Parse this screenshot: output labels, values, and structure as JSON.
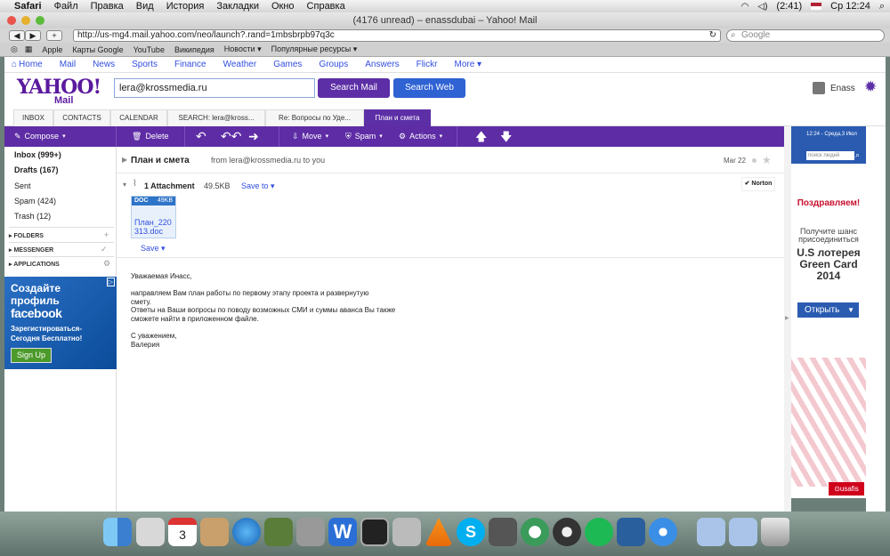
{
  "menubar": {
    "apple": "",
    "app": "Safari",
    "items": [
      "Файл",
      "Правка",
      "Вид",
      "История",
      "Закладки",
      "Окно",
      "Справка"
    ],
    "battery": "(2:41)",
    "clock": "Ср 12:24"
  },
  "window": {
    "title": "(4176 unread) – enassdubai – Yahoo! Mail",
    "url": "http://us-mg4.mail.yahoo.com/neo/launch?.rand=1mbsbrpb97q3c",
    "search_placeholder": "Google"
  },
  "bookmarks": [
    "Apple",
    "Карты Google",
    "YouTube",
    "Википедия",
    "Новости ▾",
    "Популярные ресурсы ▾"
  ],
  "yahoo_nav": [
    "Home",
    "Mail",
    "News",
    "Sports",
    "Finance",
    "Weather",
    "Games",
    "Groups",
    "Answers",
    "Flickr",
    "More ▾"
  ],
  "header": {
    "logo": "YAHOO!",
    "logo_sub": "Mail",
    "search_value": "lera@krossmedia.ru",
    "search_mail": "Search Mail",
    "search_web": "Search Web",
    "user": "Enass"
  },
  "tabs": [
    "INBOX",
    "CONTACTS",
    "CALENDAR",
    "SEARCH: lera@kross...",
    "Re: Вопросы по Уде...",
    "План и смета"
  ],
  "actions": {
    "compose": "Compose",
    "delete": "Delete",
    "move": "Move",
    "spam": "Spam",
    "actions": "Actions"
  },
  "sidebar": {
    "folders": [
      {
        "label": "Inbox (999+)",
        "bold": true
      },
      {
        "label": "Drafts (167)",
        "bold": true
      },
      {
        "label": "Sent",
        "bold": false
      },
      {
        "label": "Spam (424)",
        "bold": false
      },
      {
        "label": "Trash (12)",
        "bold": false
      }
    ],
    "sections": [
      "FOLDERS",
      "MESSENGER",
      "APPLICATIONS"
    ],
    "ad": {
      "line1": "Создайте",
      "line2": "профиль",
      "brand": "facebook",
      "line3": "Зарегистироваться-",
      "line4": "Сегодня Бесплатно!",
      "button": "Sign Up"
    }
  },
  "message": {
    "subject": "План и смета",
    "from": "from lera@krossmedia.ru to you",
    "date": "Mar 22",
    "attachments_label": "1 Attachment",
    "attachments_size": "49.5KB",
    "save_to": "Save to",
    "file": {
      "type": "DOC",
      "size": "49KB",
      "name": "План_220313.doc",
      "save": "Save"
    },
    "body": [
      "Уважаемая Инасс,",
      "",
      "направляем  Вам  план  работы  по  первому этапу проекта и развернутую",
      "смету.",
      "Ответы на Ваши вопросы по поводу возможных СМИ и суммы аванса Вы также",
      "сможете найти в приложенном файле.",
      "",
      "С уважением,",
      "Валерия"
    ]
  },
  "right_ad": {
    "top": "12:24 - Среда,3 Июл",
    "search": "поиск людей",
    "headline": "Поздравляем!",
    "sub1": "Получите шанс",
    "sub2": "присоединиться",
    "big1": "U.S лотерея",
    "big2": "Green Card",
    "big3": "2014",
    "button": "Открыть",
    "brand": "usafis"
  },
  "colors": {
    "yahoo_purple": "#5e2ca5",
    "link_blue": "#324fe1",
    "fb_blue": "#2a6fc4"
  }
}
